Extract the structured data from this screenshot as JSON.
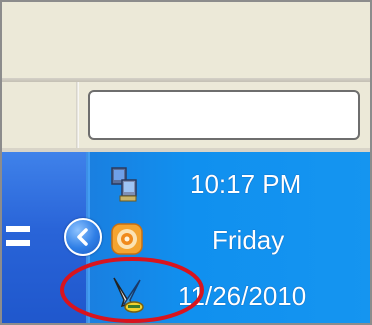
{
  "clock": {
    "time": "10:17 PM",
    "day": "Friday",
    "date": "1‌1/26/2010"
  },
  "tray_icons": [
    {
      "icon": "network-icon"
    },
    {
      "icon": "media-player-icon"
    },
    {
      "icon": "safely-remove-hardware-icon"
    }
  ],
  "controls": {
    "show_hidden_icons": "chevron-left-icon"
  },
  "colors": {
    "taskbar": "#2964d8",
    "tray": "#1090ef",
    "annotation_circle": "#d8141e",
    "clock_text": "#ffffff"
  }
}
